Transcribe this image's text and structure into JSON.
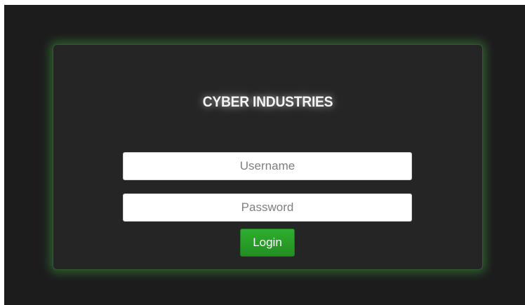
{
  "login": {
    "title": "CYBER INDUSTRIES",
    "username_placeholder": "Username",
    "password_placeholder": "Password",
    "login_label": "Login"
  },
  "colors": {
    "background": "#1c1c1c",
    "panel": "#252525",
    "panel_glow": "#46b446",
    "button": "#28a028"
  }
}
